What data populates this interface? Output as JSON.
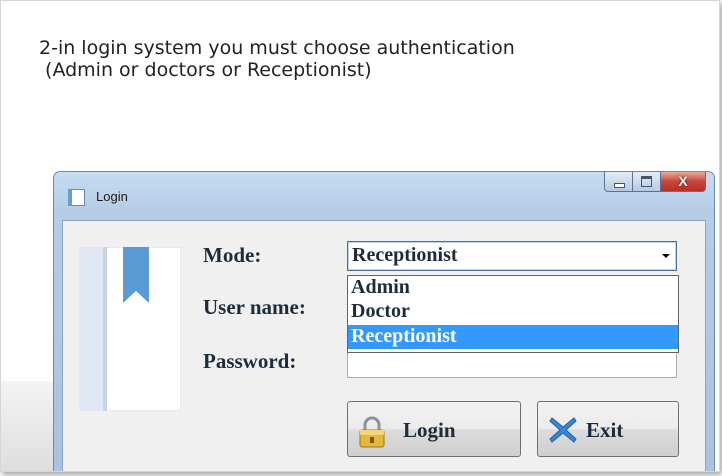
{
  "caption": {
    "line1": "2-in login system you must choose authentication",
    "line2": " (Admin or doctors or Receptionist)"
  },
  "window": {
    "title": "Login",
    "close_glyph": "X",
    "buttons": {
      "minimize": "minimize-icon",
      "maximize": "maximize-icon",
      "close": "close-icon"
    }
  },
  "form": {
    "mode_label": "Mode:",
    "username_label": "User name:",
    "password_label": "Password:",
    "mode_selected": "Receptionist",
    "mode_options": [
      "Admin",
      "Doctor",
      "Receptionist"
    ],
    "highlighted_option": "Receptionist",
    "password_value": ""
  },
  "actions": {
    "login_label": "Login",
    "exit_label": "Exit",
    "login_icon": "lock-icon",
    "exit_icon": "x-mark-icon"
  },
  "colors": {
    "selection": "#3399ff",
    "exit_icon": "#3a86d6",
    "logo_bookmark": "#5b9bd5"
  }
}
